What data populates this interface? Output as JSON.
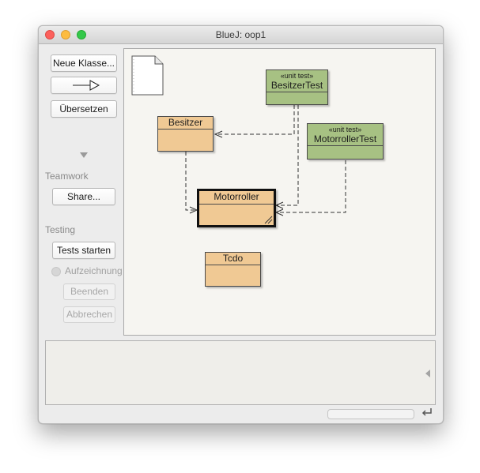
{
  "window": {
    "title": "BlueJ:  oop1"
  },
  "sidebar": {
    "new_class_label": "Neue Klasse...",
    "compile_label": "Übersetzen",
    "teamwork": {
      "label": "Teamwork",
      "share_label": "Share..."
    },
    "testing": {
      "label": "Testing",
      "run_tests_label": "Tests starten",
      "recording_label": "Aufzeichnung",
      "end_label": "Beenden",
      "cancel_label": "Abbrechen"
    }
  },
  "diagram": {
    "classes": [
      {
        "name": "BesitzerTest",
        "stereotype": "«unit test»",
        "kind": "test"
      },
      {
        "name": "Besitzer",
        "stereotype": "",
        "kind": "class"
      },
      {
        "name": "MotorrollerTest",
        "stereotype": "«unit test»",
        "kind": "test"
      },
      {
        "name": "Motorroller",
        "stereotype": "",
        "kind": "class",
        "selected": true
      },
      {
        "name": "Tcdo",
        "stereotype": "",
        "kind": "class"
      }
    ]
  },
  "colors": {
    "class_fill": "#f0c994",
    "test_fill": "#a7c183",
    "canvas_bg": "#f6f5f1"
  },
  "icons": {
    "readme": "document-icon",
    "inheritance_arrow": "arrow-right-icon",
    "collapse": "triangle-down-icon",
    "terminal_toggle": "triangle-left-icon",
    "status_return": "return-icon"
  }
}
